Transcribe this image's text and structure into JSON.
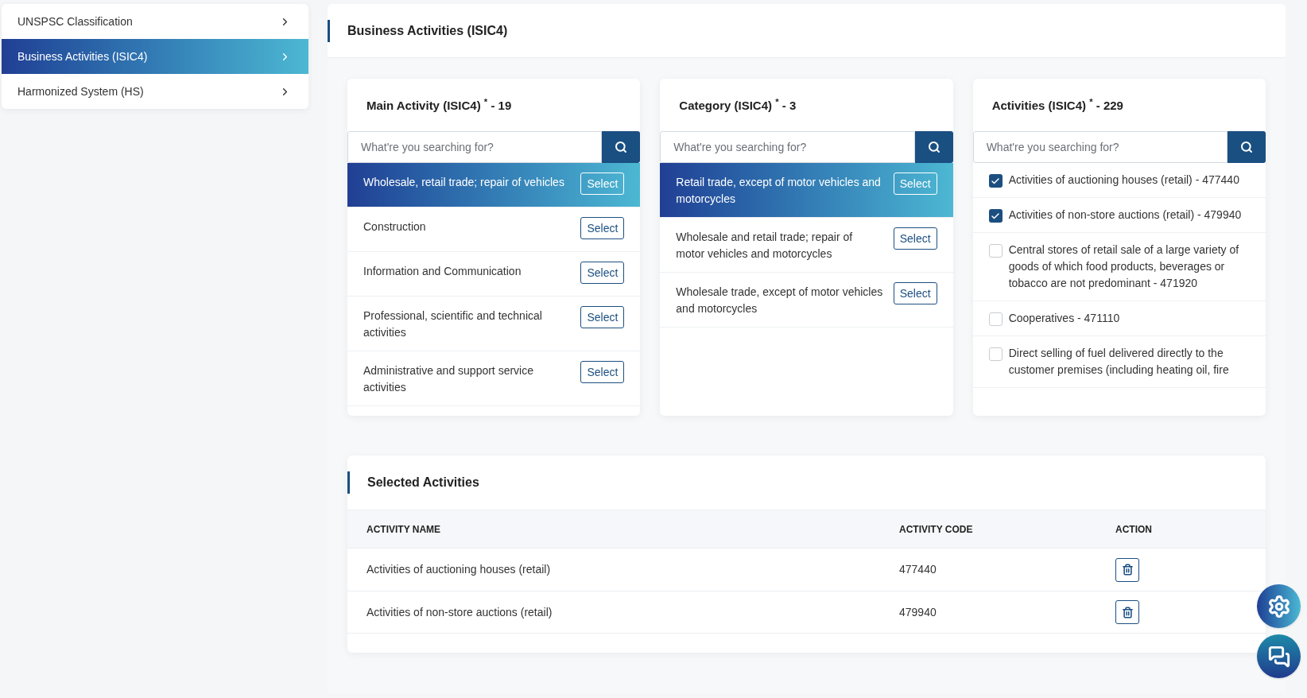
{
  "sidebar": {
    "items": [
      {
        "label": "UNSPSC Classification",
        "selected": false
      },
      {
        "label": "Business Activities (ISIC4)",
        "selected": true
      },
      {
        "label": "Harmonized System (HS)",
        "selected": false
      }
    ]
  },
  "panel": {
    "title": "Business Activities (ISIC4)"
  },
  "columns": [
    {
      "kind": "select_list",
      "title": "Main Activity (ISIC4)",
      "required_mark": "*",
      "count": "- 19",
      "search": {
        "placeholder": "What're you searching for?"
      },
      "items": [
        {
          "label": "Wholesale, retail trade; repair of vehicles",
          "selected": true,
          "button": "Select"
        },
        {
          "label": "Construction",
          "selected": false,
          "button": "Select"
        },
        {
          "label": "Information and Communication",
          "selected": false,
          "button": "Select"
        },
        {
          "label": "Professional, scientific and technical activities",
          "selected": false,
          "button": "Select"
        },
        {
          "label": "Administrative and support service activities",
          "selected": false,
          "button": "Select"
        }
      ]
    },
    {
      "kind": "select_list",
      "title": "Category (ISIC4)",
      "required_mark": "*",
      "count": "- 3",
      "search": {
        "placeholder": "What're you searching for?"
      },
      "items": [
        {
          "label": "Retail trade, except of motor vehicles and motorcycles",
          "selected": true,
          "button": "Select"
        },
        {
          "label": "Wholesale and retail trade; repair of motor vehicles and motorcycles",
          "selected": false,
          "button": "Select"
        },
        {
          "label": "Wholesale trade, except of motor vehicles and motorcycles",
          "selected": false,
          "button": "Select"
        }
      ]
    },
    {
      "kind": "checkbox_list",
      "title": "Activities (ISIC4)",
      "required_mark": "*",
      "count": "- 229",
      "search": {
        "placeholder": "What're you searching for?"
      },
      "items": [
        {
          "label": "Activities of auctioning houses (retail) - 477440",
          "checked": true
        },
        {
          "label": "Activities of non-store auctions (retail) - 479940",
          "checked": true
        },
        {
          "label": "Central stores of retail sale of a large variety of goods of which food products, beverages or tobacco are not predominant - 471920",
          "checked": false
        },
        {
          "label": "Cooperatives - 471110",
          "checked": false
        },
        {
          "label": "Direct selling of fuel delivered directly to the customer premises (including heating oil, fire",
          "checked": false
        }
      ]
    }
  ],
  "selected_activities": {
    "title": "Selected Activities",
    "table": {
      "columns": [
        "ACTIVITY NAME",
        "ACTIVITY CODE",
        "ACTION"
      ],
      "rows": [
        {
          "name": "Activities of auctioning houses (retail)",
          "code": "477440"
        },
        {
          "name": "Activities of non-store auctions (retail)",
          "code": "479940"
        }
      ]
    }
  }
}
